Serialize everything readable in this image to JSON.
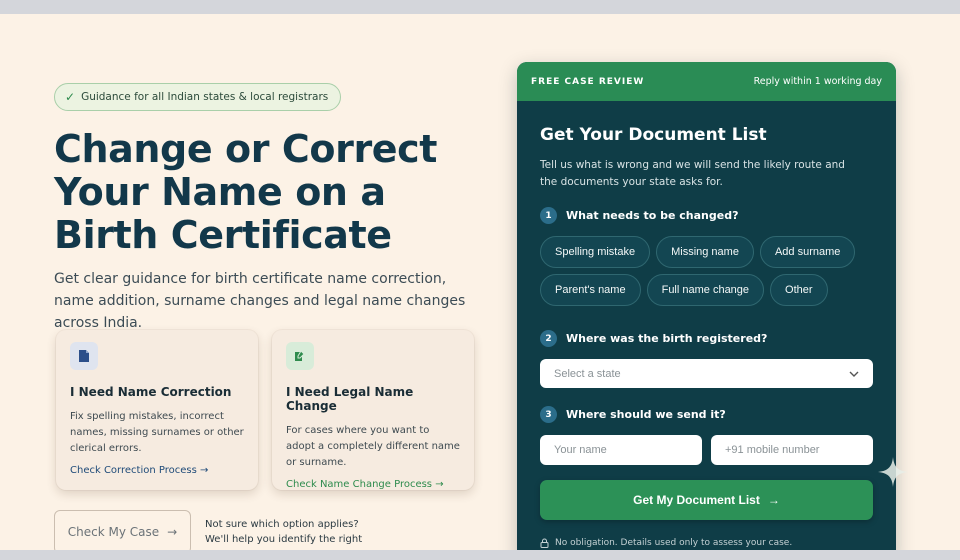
{
  "hero": {
    "trust_badge": "Guidance for all Indian states & local registrars",
    "title": "Change or Correct Your Name on a Birth Certificate",
    "subtitle": "Get clear guidance for birth certificate name correction, name addition, surname changes and legal name changes across India."
  },
  "cards": [
    {
      "title": "I Need Name Correction",
      "text": "Fix spelling mistakes, incorrect names, missing surnames or other clerical errors.",
      "link": "Check Correction Process",
      "icon": "document-icon"
    },
    {
      "title": "I Need Legal Name Change",
      "text": "For cases where you want to adopt a completely different name or surname.",
      "link": "Check Name Change Process",
      "icon": "edit-document-icon"
    }
  ],
  "cta": {
    "check_case_label": "Check My Case",
    "help_text": "Not sure which option applies? We'll help you identify the right process."
  },
  "panel": {
    "badge": "FREE CASE REVIEW",
    "reply": "Reply within 1 working day",
    "title": "Get Your Document List",
    "description": "Tell us what is wrong and we will send the likely route and the documents your state asks for.",
    "steps": [
      {
        "num": "1",
        "label": "What needs to be changed?"
      },
      {
        "num": "2",
        "label": "Where was the birth registered?"
      },
      {
        "num": "3",
        "label": "Where should we send it?"
      }
    ],
    "chips_row1": [
      "Spelling mistake",
      "Missing name",
      "Add surname"
    ],
    "chips_row2": [
      "Parent's name",
      "Full name change",
      "Other"
    ],
    "state_select": "Select a state",
    "name_placeholder": "Your name",
    "mobile_placeholder": "+91 mobile number",
    "submit_label": "Get My Document List",
    "footnote": "No obligation. Details used only to assess your case."
  },
  "colors": {
    "background": "#fcf2e6",
    "panel": "#0f3d47",
    "panel_header": "#2a8c55",
    "accent_green": "#2c9157",
    "title_navy": "#12384a"
  }
}
